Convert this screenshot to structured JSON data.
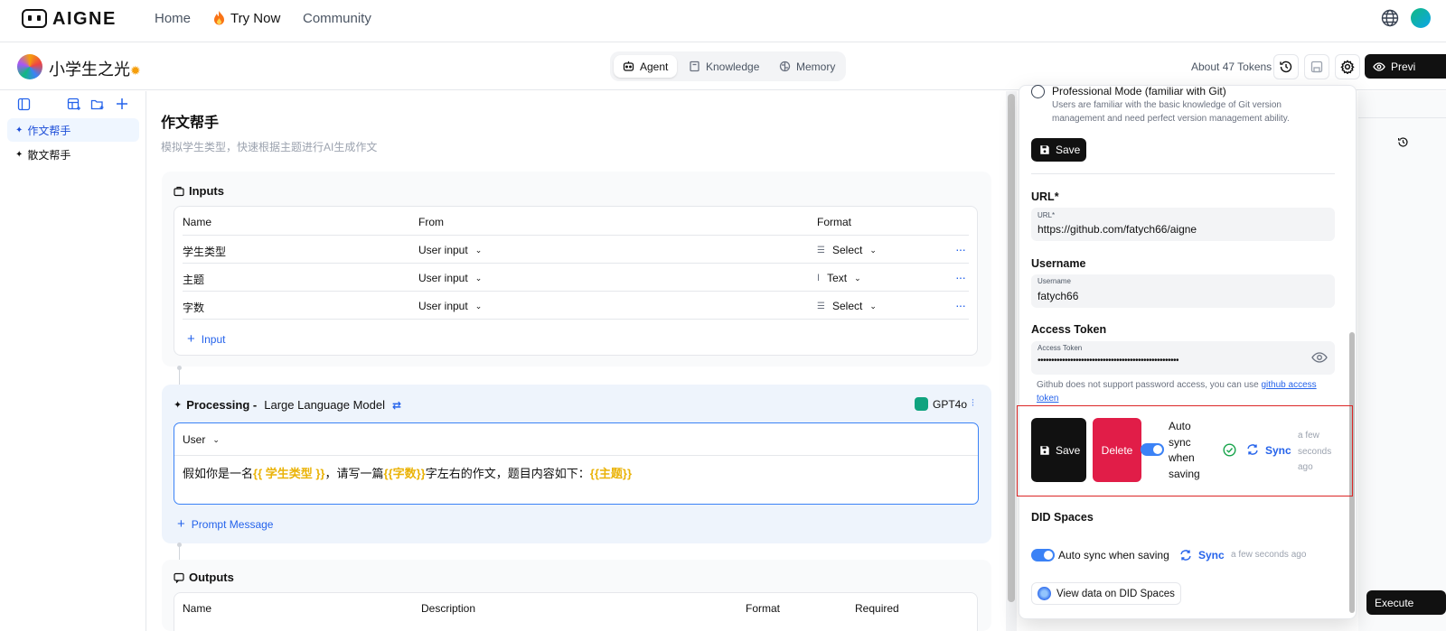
{
  "topnav": {
    "logo_text": "AIGNE",
    "links": [
      {
        "label": "Home"
      },
      {
        "label": "Try Now"
      },
      {
        "label": "Community"
      }
    ]
  },
  "header": {
    "project_title": "小学生之光",
    "tabs": [
      {
        "label": "Agent",
        "active": true
      },
      {
        "label": "Knowledge",
        "active": false
      },
      {
        "label": "Memory",
        "active": false
      }
    ],
    "tokens": "About 47 Tokens",
    "preview_label": "Previ"
  },
  "sidebar": {
    "items": [
      {
        "label": "作文帮手",
        "active": true
      },
      {
        "label": "散文帮手",
        "active": false
      }
    ]
  },
  "main": {
    "title": "作文帮手",
    "description": "模拟学生类型，快速根据主题进行AI生成作文",
    "inputs": {
      "heading": "Inputs",
      "columns": [
        "Name",
        "From",
        "Format"
      ],
      "rows": [
        {
          "name": "学生类型",
          "from": "User input",
          "format": "Select"
        },
        {
          "name": "主题",
          "from": "User input",
          "format": "Text"
        },
        {
          "name": "字数",
          "from": "User input",
          "format": "Select"
        }
      ],
      "add_label": "Input"
    },
    "processing": {
      "heading": "Processing -",
      "subheading": "Large Language Model",
      "model": "GPT4o",
      "role": "User",
      "prompt_parts": [
        {
          "text": "假如你是一名",
          "var": false
        },
        {
          "text": "{{ 学生类型 }}",
          "var": true
        },
        {
          "text": "，请写一篇",
          "var": false
        },
        {
          "text": "{{字数}}",
          "var": true
        },
        {
          "text": "字左右的作文，题目内容如下：",
          "var": false
        },
        {
          "text": "{{主题}}",
          "var": true
        }
      ],
      "add_label": "Prompt Message"
    },
    "outputs": {
      "heading": "Outputs",
      "columns": [
        "Name",
        "Description",
        "Format",
        "Required"
      ]
    }
  },
  "panel": {
    "mode_title": "Professional Mode (familiar with Git)",
    "mode_desc_1": "Users are familiar with the basic knowledge of Git version",
    "mode_desc_2": "management and need perfect version management ability.",
    "save_label": "Save",
    "url": {
      "label": "URL*",
      "field_label": "URL*",
      "value": "https://github.com/fatych66/aigne"
    },
    "username": {
      "label": "Username",
      "field_label": "Username",
      "value": "fatych66"
    },
    "token": {
      "label": "Access Token",
      "field_label": "Access Token",
      "value": "••••••••••••••••••••••••••••••••••••••••••••••••••••"
    },
    "hint_text": "Github does not support password access, you can use",
    "hint_link_1": "github",
    "hint_link_2": "access token",
    "git_actions": {
      "save_label": "Save",
      "delete_label": "Delete",
      "auto_sync_lines": [
        "Auto",
        "sync",
        "when",
        "saving"
      ],
      "sync_label": "Sync",
      "ago_lines": [
        "a few",
        "seconds",
        "ago"
      ]
    },
    "did": {
      "heading": "DID Spaces",
      "auto_sync": "Auto sync when saving",
      "sync_label": "Sync",
      "ago": "a few seconds ago",
      "view_label": "View data on DID Spaces"
    }
  },
  "execute_label": "Execute",
  "colors": {
    "accent": "#2563eb",
    "danger": "#e11d48",
    "highlight_box": "#dc2626",
    "variable": "#eab308"
  }
}
